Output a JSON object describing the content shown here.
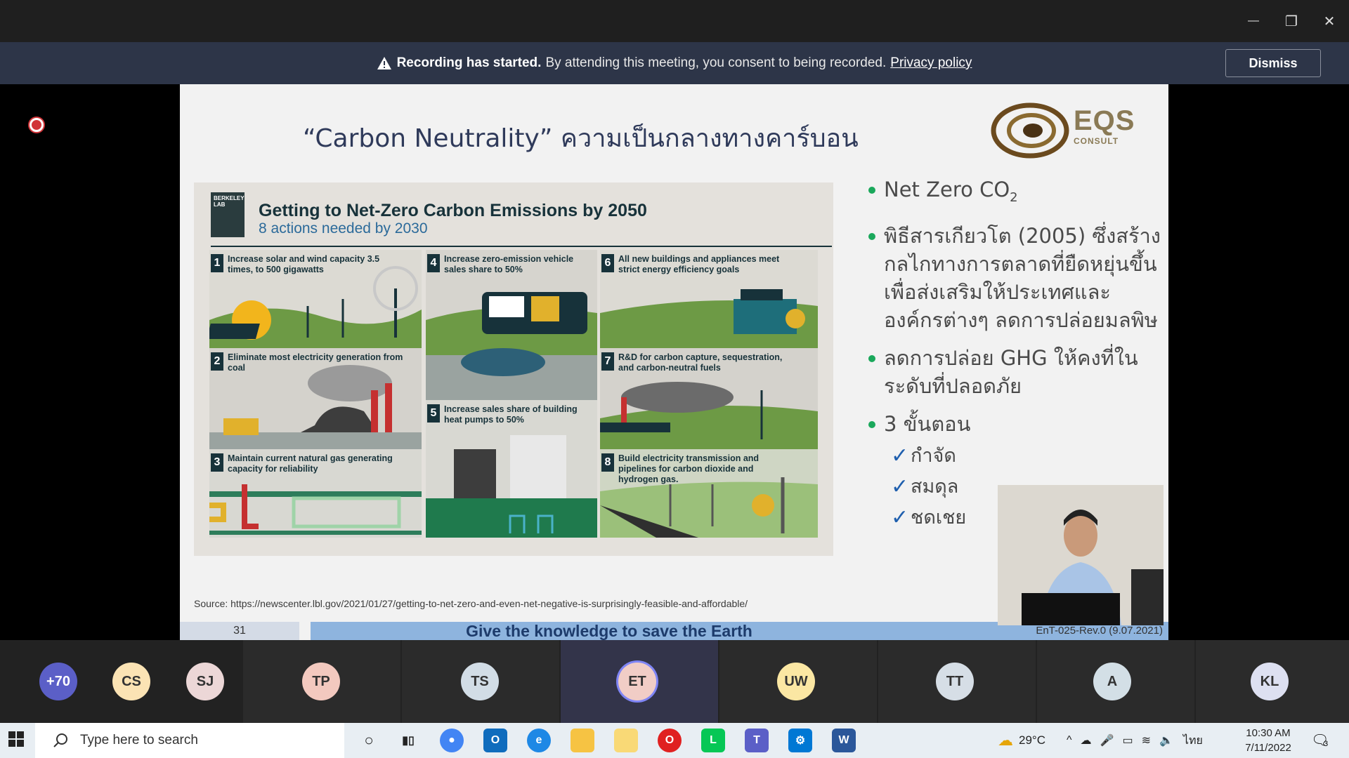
{
  "window": {
    "minimize": "—",
    "restore": "❐",
    "close": "✕"
  },
  "banner": {
    "title": "Recording has started.",
    "message": "By attending this meeting, you consent to being recorded.",
    "link": "Privacy policy",
    "dismiss": "Dismiss"
  },
  "slide": {
    "title": "“Carbon Neutrality” ความเป็นกลางทางคาร์บอน",
    "logo_text": "EQS",
    "logo_sub": "CONSULT",
    "infographic": {
      "badge": "BERKELEY LAB",
      "title": "Getting to Net-Zero Carbon Emissions by 2050",
      "subtitle": "8 actions needed by 2030",
      "actions": [
        {
          "n": "1",
          "text": "Increase solar and wind capacity 3.5 times, to 500 gigawatts"
        },
        {
          "n": "2",
          "text": "Eliminate most electricity generation from coal"
        },
        {
          "n": "3",
          "text": "Maintain current natural gas generating capacity for reliability"
        },
        {
          "n": "4",
          "text": "Increase zero-emission vehicle sales share to 50%"
        },
        {
          "n": "5",
          "text": "Increase sales share of building heat pumps to 50%"
        },
        {
          "n": "6",
          "text": "All new buildings and appliances meet strict energy efficiency goals"
        },
        {
          "n": "7",
          "text": "R&D for carbon capture, sequestration, and carbon-neutral fuels"
        },
        {
          "n": "8",
          "text": "Build electricity transmission and pipelines for carbon dioxide and hydrogen gas."
        }
      ]
    },
    "bullets": {
      "b1": "Net Zero CO",
      "b1_sub": "2",
      "b2": "พิธีสารเกียวโต (2005) ซึ่งสร้างกลไกทางการตลาดที่ยืดหยุ่นขึ้นเพื่อส่งเสริมให้ประเทศและองค์กรต่างๆ ลดการปล่อยมลพิษ",
      "b3": "ลดการปล่อย GHG ให้คงที่ในระดับที่ปลอดภัย",
      "b4": "3 ขั้นตอน",
      "steps": [
        "กำจัด",
        "สมดุล",
        "ชดเชย"
      ]
    },
    "source": "Source: https://newscenter.lbl.gov/2021/01/27/getting-to-net-zero-and-even-net-negative-is-surprisingly-feasible-and-affordable/",
    "page_number": "31",
    "footer": "Give the knowledge to save the Earth",
    "revision": "EnT-025-Rev.0 (9.07.2021)"
  },
  "participants": [
    {
      "initials": "+70",
      "color": "#5b5fc7"
    },
    {
      "initials": "CS",
      "color": "#fbe3b4"
    },
    {
      "initials": "SJ",
      "color": "#ecd7d7"
    },
    {
      "initials": "TP",
      "color": "#f3c9bf"
    },
    {
      "initials": "TS",
      "color": "#d2dde6"
    },
    {
      "initials": "ET",
      "color": "#f1cdc6"
    },
    {
      "initials": "UW",
      "color": "#fbe7a3"
    },
    {
      "initials": "TT",
      "color": "#d6dee6"
    },
    {
      "initials": "A",
      "color": "#d3dfe6"
    },
    {
      "initials": "KL",
      "color": "#dde0f1"
    }
  ],
  "taskbar": {
    "search_placeholder": "Type here to search",
    "weather": "29°C",
    "lang": "ไทย",
    "time": "10:30 AM",
    "date": "7/11/2022",
    "notif_count": "3"
  }
}
